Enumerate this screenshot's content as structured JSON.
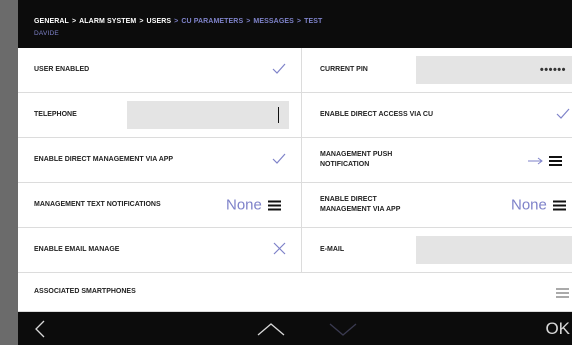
{
  "breadcrumb": {
    "items": [
      {
        "label": "GENERAL",
        "active": true
      },
      {
        "label": "ALARM SYSTEM",
        "active": true
      },
      {
        "label": "USERS",
        "active": true
      },
      {
        "label": "CU PARAMETERS",
        "active": false
      },
      {
        "label": "MESSAGES",
        "active": false
      },
      {
        "label": "TEST",
        "active": false
      }
    ],
    "separator": ">",
    "subtitle": "DAVIDE"
  },
  "rows": {
    "user_enabled": {
      "label": "USER ENABLED",
      "icon": "check-icon"
    },
    "current_pin": {
      "label": "CURRENT PIN",
      "value": "••••••"
    },
    "telephone": {
      "label": "TELEPHONE",
      "value": ""
    },
    "direct_access": {
      "label": "ENABLE DIRECT ACCESS VIA CU",
      "icon": "check-icon"
    },
    "direct_mgmt_app_left": {
      "label": "ENABLE DIRECT MANAGEMENT VIA APP",
      "icon": "check-icon"
    },
    "push_notification": {
      "label": "MANAGEMENT PUSH NOTIFICATION",
      "icon": "arrow-right-icon"
    },
    "text_notifications": {
      "label": "MANAGEMENT TEXT NOTIFICATIONS",
      "value": "None"
    },
    "direct_mgmt_app_right": {
      "label": "ENABLE DIRECT MANAGEMENT VIA APP",
      "value": "None"
    },
    "email_manage": {
      "label": "ENABLE EMAIL MANAGE",
      "icon": "cross-icon"
    },
    "email": {
      "label": "E-MAIL",
      "value": ""
    },
    "smartphones": {
      "label": "ASSOCIATED SMARTPHONES",
      "icon": "menu-icon"
    }
  },
  "footer": {
    "back_icon": "chevron-left-icon",
    "up_icon": "chevron-up-icon",
    "down_icon": "chevron-down-icon",
    "ok_label": "OK"
  },
  "colors": {
    "accent": "#7e82c9",
    "header_bg": "#0c0c0c",
    "field_bg": "#e4e4e4"
  }
}
